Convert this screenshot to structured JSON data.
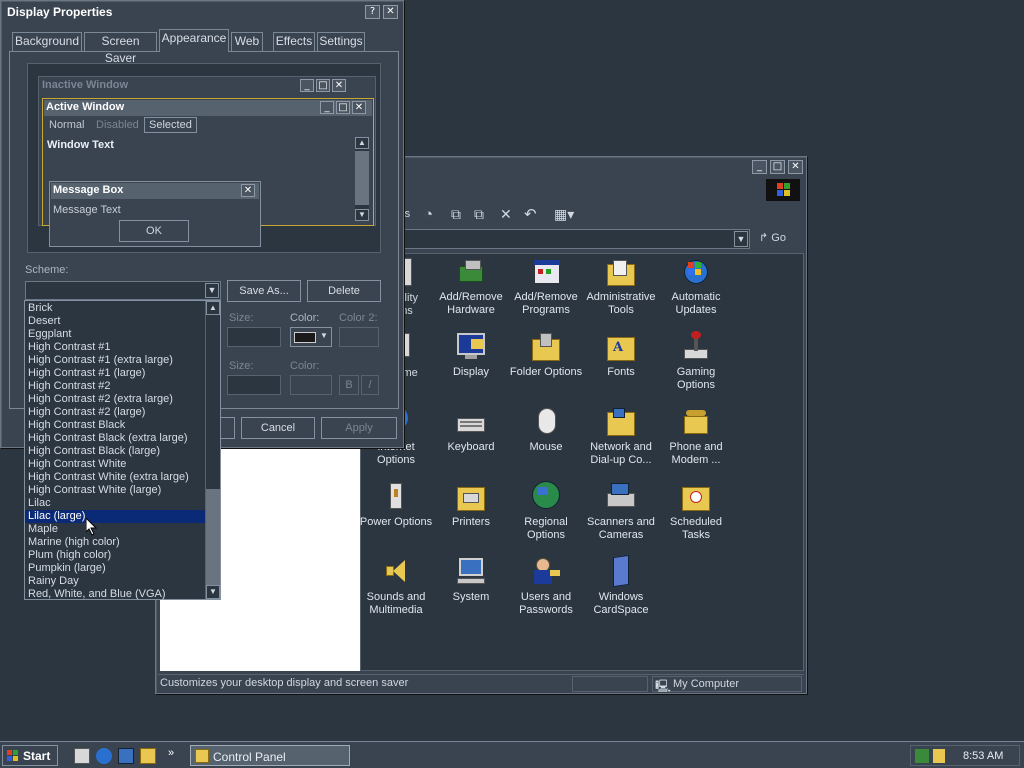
{
  "display_props": {
    "title": "Display Properties",
    "tabs": [
      "Background",
      "Screen Saver",
      "Appearance",
      "Web",
      "Effects",
      "Settings"
    ],
    "active_tab": "Appearance",
    "preview": {
      "inactive_title": "Inactive Window",
      "active_title": "Active Window",
      "menu_normal": "Normal",
      "menu_disabled": "Disabled",
      "menu_selected": "Selected",
      "window_text": "Window Text",
      "msgbox_title": "Message Box",
      "msgbox_text": "Message Text",
      "ok": "OK"
    },
    "scheme_label": "Scheme:",
    "save_as": "Save As...",
    "delete": "Delete",
    "size_label": "Size:",
    "color_label": "Color:",
    "color2_label": "Color 2:",
    "bold": "B",
    "italic": "/",
    "cancel": "Cancel",
    "apply": "Apply"
  },
  "scheme_list": {
    "items": [
      "Brick",
      "Desert",
      "Eggplant",
      "High Contrast #1",
      "High Contrast #1 (extra large)",
      "High Contrast #1 (large)",
      "High Contrast #2",
      "High Contrast #2 (extra large)",
      "High Contrast #2 (large)",
      "High Contrast Black",
      "High Contrast Black (extra large)",
      "High Contrast Black (large)",
      "High Contrast White",
      "High Contrast White (extra large)",
      "High Contrast White (large)",
      "Lilac",
      "Lilac (large)",
      "Maple",
      "Marine (high color)",
      "Plum (high color)",
      "Pumpkin (large)",
      "Rainy Day",
      "Red, White, and Blue (VGA)"
    ],
    "selected": "Lilac (large)"
  },
  "control_panel": {
    "go": "Go",
    "items": [
      [
        "Accessibility Options",
        "Add/Remove Hardware",
        "Add/Remove Programs",
        "Administrative Tools",
        "Automatic Updates"
      ],
      [
        "Date/Time",
        "Display",
        "Folder Options",
        "Fonts",
        "Gaming Options"
      ],
      [
        "Internet Options",
        "Keyboard",
        "Mouse",
        "Network and Dial-up Co...",
        "Phone and Modem ..."
      ],
      [
        "Power Options",
        "Printers",
        "Regional Options",
        "Scanners and Cameras",
        "Scheduled Tasks"
      ],
      [
        "Sounds and Multimedia",
        "System",
        "Users and Passwords",
        "Windows CardSpace"
      ]
    ],
    "partial_labels": {
      "acc1": "bility",
      "acc2": "ns",
      "date": "ime",
      "inet1": "Internet",
      "inet2": "Options"
    },
    "status_text": "Customizes your desktop display and screen saver",
    "status_zone": "My Computer"
  },
  "taskbar": {
    "start": "Start",
    "task": "Control Panel",
    "clock": "8:53 AM",
    "more": "»"
  },
  "colors": {
    "desktop": "#2c3641",
    "selection": "#0a2a78",
    "titlebar": "#46525e"
  }
}
